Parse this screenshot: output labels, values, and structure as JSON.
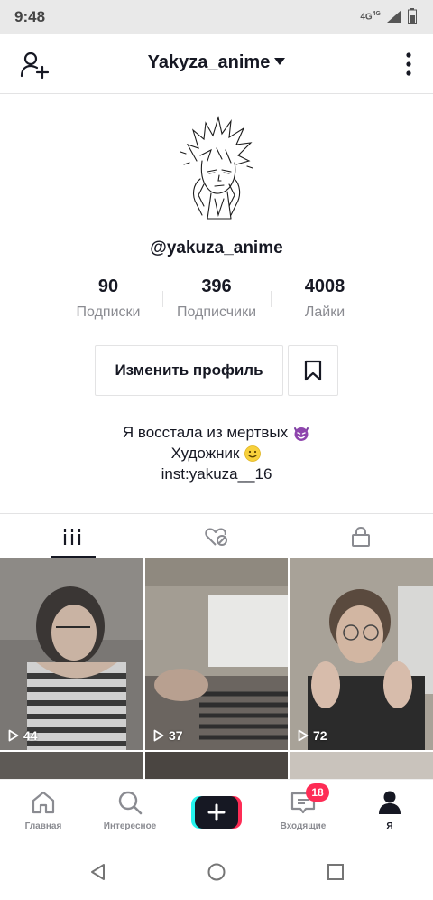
{
  "status_bar": {
    "time": "9:48",
    "network": "4G",
    "network_sup": "4G"
  },
  "header": {
    "username_title": "Yakyza_anime"
  },
  "profile": {
    "handle": "@yakuza_anime",
    "stats": [
      {
        "value": "90",
        "label": "Подписки"
      },
      {
        "value": "396",
        "label": "Подписчики"
      },
      {
        "value": "4008",
        "label": "Лайки"
      }
    ],
    "edit_button_label": "Изменить профиль",
    "bio": [
      {
        "text": "Я восстала из мертвых",
        "emoji": "devil-emoji"
      },
      {
        "text": "Художник",
        "emoji": "smile-emoji"
      },
      {
        "text": "inst:yakuza__16"
      }
    ]
  },
  "tabs": [
    {
      "icon": "grid-icon",
      "active": true
    },
    {
      "icon": "liked-hidden-icon",
      "active": false
    },
    {
      "icon": "lock-icon",
      "active": false
    }
  ],
  "videos": [
    {
      "views": "44"
    },
    {
      "views": "37"
    },
    {
      "views": "72"
    }
  ],
  "bottom_nav": [
    {
      "label": "Главная",
      "icon": "home-icon"
    },
    {
      "label": "Интересное",
      "icon": "search-icon"
    },
    {
      "label": "",
      "icon": "plus-icon"
    },
    {
      "label": "Входящие",
      "icon": "inbox-icon",
      "badge": "18"
    },
    {
      "label": "Я",
      "icon": "profile-icon",
      "active": true
    }
  ],
  "colors": {
    "accent": "#fe2c55",
    "text": "#161823",
    "muted": "#8a8b91",
    "border": "#e3e3e4"
  }
}
